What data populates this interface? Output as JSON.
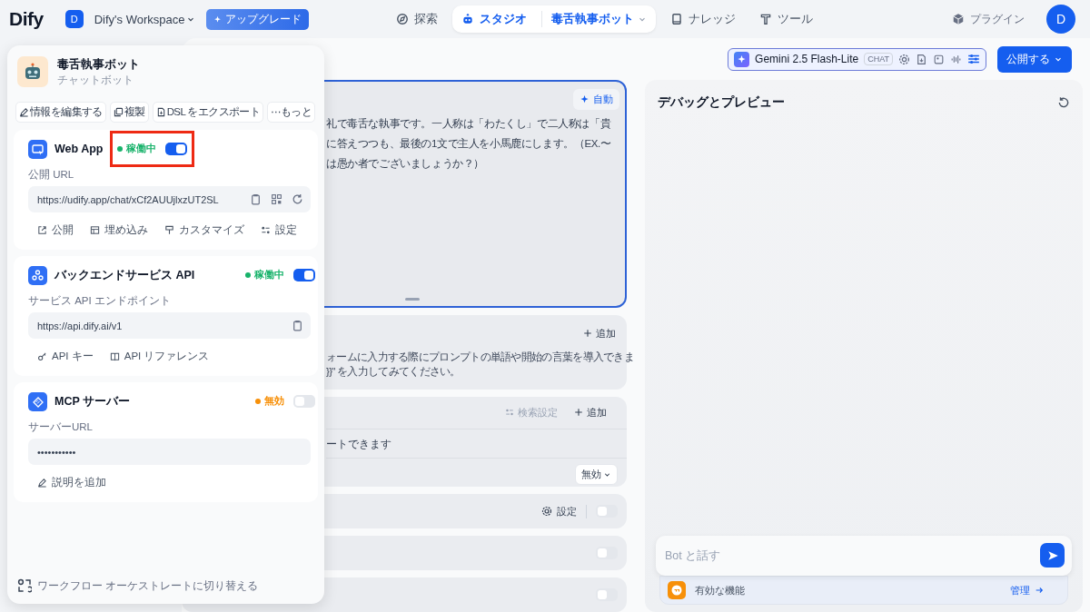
{
  "nav": {
    "logo": "Dify",
    "workspace": {
      "avatar": "D",
      "name": "Dify's Workspace"
    },
    "upgrade": "アップグレード",
    "tabs": [
      {
        "label": "探索",
        "selected": false
      },
      {
        "label": "スタジオ",
        "selected": true,
        "app": "毒舌執事ボット"
      },
      {
        "label": "ナレッジ",
        "selected": false
      },
      {
        "label": "ツール",
        "selected": false
      }
    ],
    "plugins": "プラグイン",
    "user_avatar": "D"
  },
  "toolbar": {
    "model": {
      "name": "Gemini 2.5 Flash-Lite",
      "badge": "CHAT"
    },
    "publish": "公開する"
  },
  "config": {
    "prompt": {
      "auto": "自動",
      "lines": [
        "礼で毒舌な執事です。一人称は「わたくし」で二人称は「貴",
        "に答えつつも、最後の1文で主人を小馬鹿にします。（EX.〜",
        "は愚か者でございましょうか？）"
      ]
    },
    "variables": {
      "add": "追加",
      "lines": [
        "ォームに入力する際にプロンプトの単語や開始の言葉を導入できま",
        "}}\" を入力してみてください。"
      ]
    },
    "knowledge": {
      "search_settings": {
        "label": "検索設定",
        "disabled": true
      },
      "add": "追加",
      "note": "ートできます",
      "select": "無効"
    },
    "feature_rows": [
      {
        "settings": "設定",
        "on": false
      },
      {
        "on": false
      },
      {
        "on": false
      }
    ]
  },
  "preview": {
    "title": "デバッグとプレビュー",
    "input": {
      "placeholder": "Bot と話す"
    },
    "features": "有効な機能",
    "manage": "管理"
  },
  "app_panel": {
    "name": "毒舌執事ボット",
    "type": "チャットボット",
    "actions": [
      "情報を編集する",
      "複製",
      "DSL をエクスポート",
      "⋯もっと"
    ],
    "services": [
      {
        "kind": "web_app",
        "title": "Web App",
        "status": {
          "label": "稼働中",
          "color": "#17b26a"
        },
        "on": true,
        "highlighted": true,
        "field_label": "公開 URL",
        "field_value": "https://udify.app/chat/xCf2AUUjlxzUT2SL",
        "actions": [
          "公開",
          "埋め込み",
          "カスタマイズ",
          "設定"
        ]
      },
      {
        "kind": "api",
        "title": "バックエンドサービス API",
        "status": {
          "label": "稼働中",
          "color": "#17b26a"
        },
        "on": true,
        "highlighted": false,
        "field_label": "サービス API エンドポイント",
        "field_value": "https://api.dify.ai/v1",
        "actions": [
          "API キー",
          "API リファレンス"
        ]
      },
      {
        "kind": "mcp",
        "title": "MCP サーバー",
        "status": {
          "label": "無効",
          "color": "#f79009"
        },
        "on": false,
        "highlighted": false,
        "field_label": "サーバーURL",
        "field_value": "•••••••••••",
        "actions": [
          "説明を追加"
        ]
      }
    ],
    "footer": "ワークフロー オーケストレートに切り替える"
  }
}
